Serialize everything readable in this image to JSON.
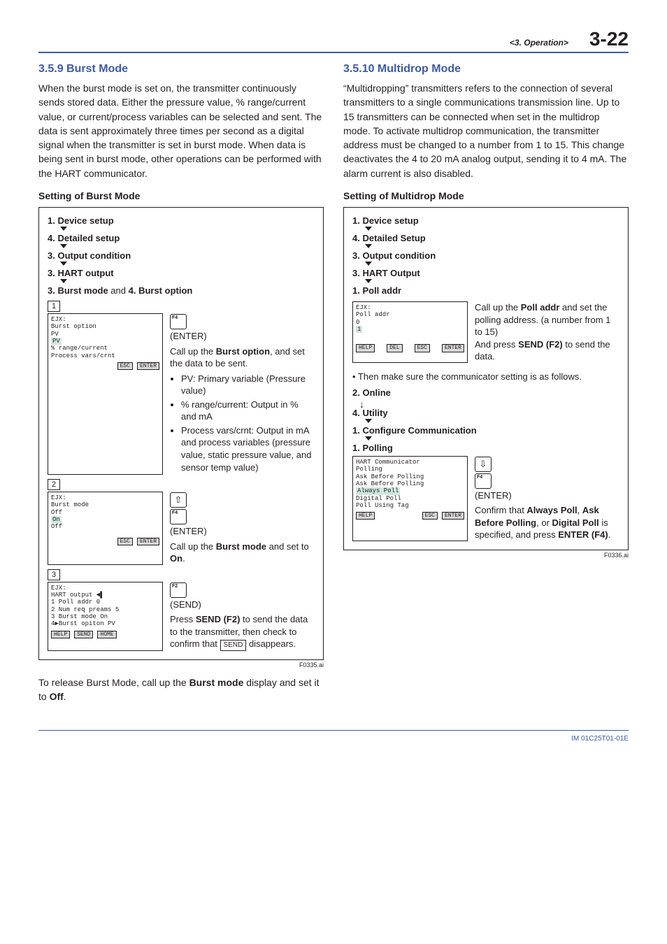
{
  "header": {
    "section_label": "<3. Operation>",
    "page_number": "3-22"
  },
  "left": {
    "heading": "3.5.9  Burst Mode",
    "body": "When the burst mode is set on, the transmitter continuously sends stored data. Either the pressure value, % range/current value, or current/process variables can be selected and sent. The data is sent approximately three times per second as a digital signal when the transmitter is set in burst mode. When data is being sent in burst mode, other operations can be performed with the HART communicator.",
    "setting_title": "Setting of Burst Mode",
    "nav": {
      "s1": "1. Device setup",
      "s2": "4. Detailed setup",
      "s3": "3. Output condition",
      "s4": "3. HART output",
      "s5_a": "3. Burst mode",
      "s5_mid": " and ",
      "s5_b": "4. Burst option"
    },
    "block1": {
      "num": "1",
      "screen": {
        "l1": "EJX:",
        "l2": "Burst option",
        "l3": "PV",
        "hl": " PV",
        "l5": " % range/current",
        "l6": " Process vars/crnt",
        "btn1": "ESC",
        "btn2": "ENTER"
      },
      "keylabel": "F4",
      "enter": "(ENTER)",
      "desc_head_a": "Call up the ",
      "desc_head_b": "Burst option",
      "desc_head_c": ", and set the data to be sent.",
      "li1": "PV: Primary variable (Pressure value)",
      "li2": "% range/current: Output in % and mA",
      "li3": "Process vars/crnt: Output in mA and process variables (pressure value, static pressure value, and sensor temp value)"
    },
    "block2": {
      "num": "2",
      "screen": {
        "l1": "EJX:",
        "l2": "Burst mode",
        "l3": "Off",
        "hl": " On",
        "l5": " Off",
        "btn1": "ESC",
        "btn2": "ENTER"
      },
      "keylabel": "F4",
      "enter": "(ENTER)",
      "desc_a": "Call up the ",
      "desc_b": "Burst mode",
      "desc_c": " and set to ",
      "desc_d": "On",
      "desc_e": "."
    },
    "block3": {
      "num": "3",
      "screen": {
        "l1": "EJX:",
        "l2": "HART output       ◄▌",
        "l3": " 1 Poll addr       0",
        "l4": " 2 Num req preams  5",
        "l5": " 3 Burst mode     On",
        "l6": " 4▶Burst opiton   PV",
        "btn1": "HELP",
        "btn2": "SEND",
        "btn3": "HOME"
      },
      "keylabel": "F2",
      "send": "(SEND)",
      "desc_a": "Press ",
      "desc_b": "SEND (F2)",
      "desc_c": " to send the data to the transmitter, then check to confirm that ",
      "desc_box": "SEND",
      "desc_d": " disappears."
    },
    "caption": "F0335.ai",
    "release_a": "To release Burst Mode, call up the ",
    "release_b": "Burst mode",
    "release_c": " display and set it to ",
    "release_d": "Off",
    "release_e": "."
  },
  "right": {
    "heading": "3.5.10 Multidrop Mode",
    "body": "“Multidropping” transmitters refers to the connection of several transmitters to a single communications transmission line. Up to 15 transmitters can be connected when set in the multidrop mode. To activate multidrop communication, the transmitter address must be changed to a number from 1 to 15. This change deactivates the 4 to 20 mA analog output, sending it to 4 mA. The alarm current is also disabled.",
    "setting_title": "Setting of Multidrop Mode",
    "nav": {
      "s1": "1. Device setup",
      "s2": "4. Detailed Setup",
      "s3": "3. Output condition",
      "s4": "3. HART Output",
      "s5": "1. Poll addr"
    },
    "block1": {
      "screen": {
        "l1": "EJX:",
        "l2": "Poll addr",
        "l3": "    0",
        "hl": " 1     ",
        "btn1": "HELP",
        "btn2": "DEL",
        "btn3": "ESC",
        "btn4": "ENTER"
      },
      "desc_a": "Call up the ",
      "desc_b": "Poll addr",
      "desc_c": " and set the polling address. (a number from 1 to 15)",
      "desc_d": "And press ",
      "desc_e": "SEND (F2)",
      "desc_f": " to send the data."
    },
    "note": "• Then make sure the communicator setting is as follows.",
    "nav2": {
      "s1": "2. Online",
      "s2": "4. Utility",
      "s3": "1. Configure Communication",
      "s4": "1. Polling"
    },
    "block2": {
      "screen": {
        "l1": "HART Communicator",
        "l2": "Polling",
        "l3": "Ask Before Polling",
        "l4": " Ask Before Polling",
        "hl": " Always Poll",
        "l6": " Digital Poll",
        "l7": " Poll Using Tag",
        "btn1": "HELP",
        "btn2": "ESC",
        "btn3": "ENTER"
      },
      "keylabel": "F4",
      "enter": "(ENTER)",
      "desc_a": "Confirm that ",
      "desc_b": "Always Poll",
      "desc_c": ", ",
      "desc_d": "Ask Before Polling",
      "desc_e": ", or ",
      "desc_f": "Digital Poll",
      "desc_g": " is specified, and press ",
      "desc_h": "ENTER (F4)",
      "desc_i": "."
    },
    "caption": "F0336.ai"
  },
  "footer": {
    "docid": "IM 01C25T01-01E"
  }
}
